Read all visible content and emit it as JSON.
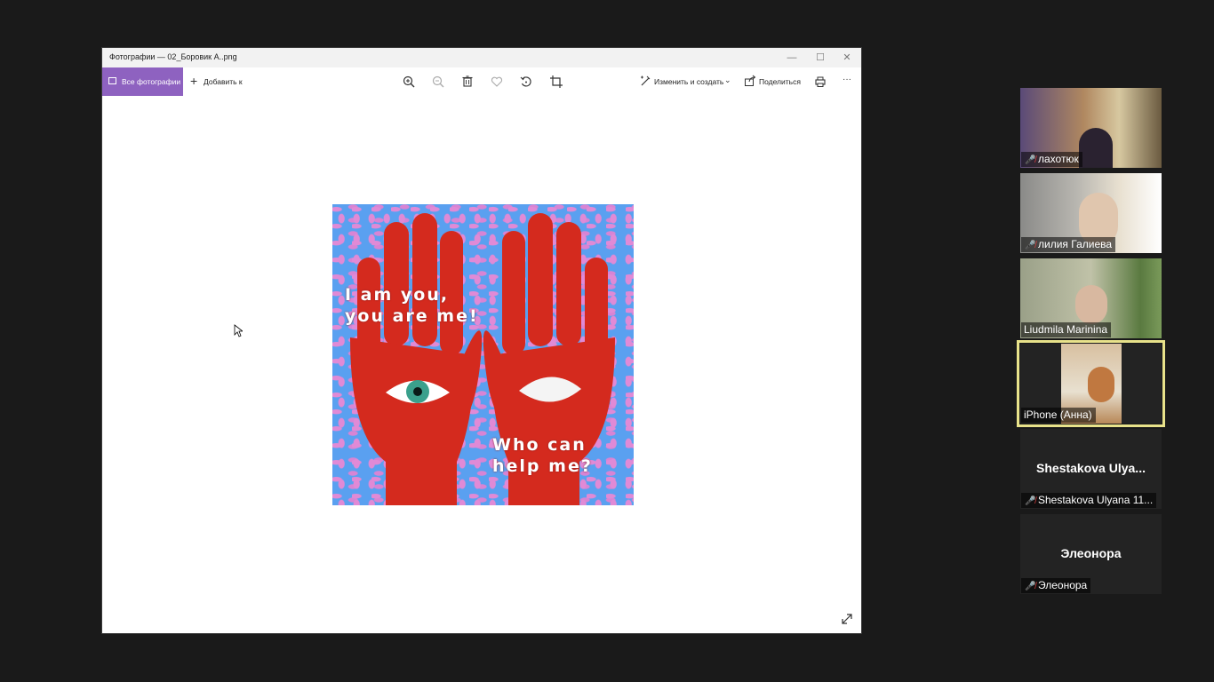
{
  "window": {
    "title": "Фотографии — 02_Боровик А..png"
  },
  "toolbar": {
    "all_photos": "Все фотографии",
    "add_to": "Добавить к",
    "edit_create": "Изменить и создать",
    "share": "Поделиться",
    "more": "···"
  },
  "poster": {
    "text_top": "I am you,\nyou are me!",
    "text_bottom": "Who can\nhelp me?"
  },
  "participants": [
    {
      "name": "лахотюк",
      "muted": true
    },
    {
      "name": "лилия Галиева",
      "muted": true
    },
    {
      "name": "Liudmila Marinina",
      "muted": false
    },
    {
      "name": "iPhone (Анна)",
      "muted": false
    },
    {
      "name": "Shestakova Ulyana 11...",
      "display": "Shestakova  Ulya...",
      "muted": true
    },
    {
      "name": "Элеонора",
      "display": "Элеонора",
      "muted": true
    }
  ],
  "colors": {
    "accent": "#8e62c0",
    "active_speaker": "#e8e28a",
    "muted_icon": "#e64040",
    "poster_bg": "#5aa0f0",
    "hand": "#d42a1e"
  }
}
